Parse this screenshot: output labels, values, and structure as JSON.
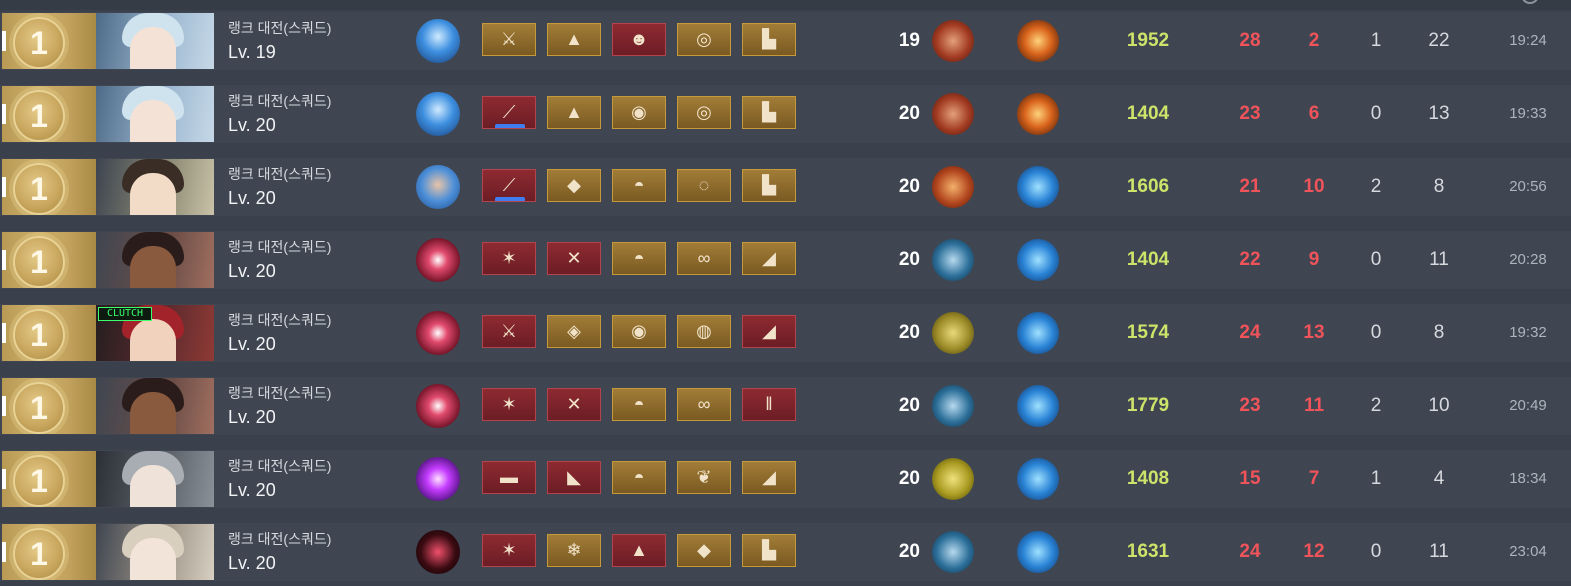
{
  "colors": {
    "score": "#cde36a",
    "kills": "#f0535a",
    "neutral": "#d6d9de",
    "time": "#aeb4bd"
  },
  "rows": [
    {
      "placement": "1",
      "mode": "랭크 대전(스쿼드)",
      "level_label": "Lv. 19",
      "char_level": "19",
      "score": "1952",
      "kills": "28",
      "assists": "2",
      "deaths": "1",
      "hunts": "22",
      "time": "19:24",
      "portrait_icon": "white-haired-character-icon",
      "skill_icon": "lightning-skill-icon",
      "weapon_icon": "sword-icon",
      "tactical_icon": "burst-tactical-icon",
      "badge": "",
      "items": [
        {
          "icon": "sword-item-icon",
          "tier": "gold"
        },
        {
          "icon": "red-cloak-icon",
          "tier": "gold"
        },
        {
          "icon": "mask-icon",
          "tier": "red"
        },
        {
          "icon": "bracelet-icon",
          "tier": "gold"
        },
        {
          "icon": "boots-icon",
          "tier": "gold"
        }
      ]
    },
    {
      "placement": "1",
      "mode": "랭크 대전(스쿼드)",
      "level_label": "Lv. 20",
      "char_level": "20",
      "score": "1404",
      "kills": "23",
      "assists": "6",
      "deaths": "0",
      "hunts": "13",
      "time": "19:33",
      "portrait_icon": "white-haired-character-icon",
      "skill_icon": "lightning-skill-icon",
      "weapon_icon": "sword-icon",
      "tactical_icon": "burst-tactical-icon",
      "badge": "",
      "items": [
        {
          "icon": "spear-item-icon",
          "tier": "red"
        },
        {
          "icon": "red-cloak-icon",
          "tier": "gold"
        },
        {
          "icon": "helmet-icon",
          "tier": "gold"
        },
        {
          "icon": "bracelet-icon",
          "tier": "gold"
        },
        {
          "icon": "boots-icon",
          "tier": "gold"
        }
      ]
    },
    {
      "placement": "1",
      "mode": "랭크 대전(스쿼드)",
      "level_label": "Lv. 20",
      "char_level": "20",
      "score": "1606",
      "kills": "21",
      "assists": "10",
      "deaths": "2",
      "hunts": "8",
      "time": "20:56",
      "portrait_icon": "green-haired-character-icon",
      "skill_icon": "fist-skill-icon",
      "weapon_icon": "bat-icon",
      "tactical_icon": "blink-tactical-icon",
      "badge": "",
      "items": [
        {
          "icon": "staff-item-icon",
          "tier": "red"
        },
        {
          "icon": "armor-icon",
          "tier": "gold"
        },
        {
          "icon": "cap-icon",
          "tier": "gold"
        },
        {
          "icon": "bangle-icon",
          "tier": "gold"
        },
        {
          "icon": "boots-icon",
          "tier": "gold"
        }
      ]
    },
    {
      "placement": "1",
      "mode": "랭크 대전(스쿼드)",
      "level_label": "Lv. 20",
      "char_level": "20",
      "score": "1404",
      "kills": "22",
      "assists": "9",
      "deaths": "0",
      "hunts": "11",
      "time": "20:28",
      "portrait_icon": "dark-haired-character-icon",
      "skill_icon": "grin-skill-icon",
      "weapon_icon": "shuriken-icon",
      "tactical_icon": "blink-tactical-icon",
      "badge": "",
      "items": [
        {
          "icon": "throwing-star-item-icon",
          "tier": "red"
        },
        {
          "icon": "harness-icon",
          "tier": "red"
        },
        {
          "icon": "cap-icon",
          "tier": "gold"
        },
        {
          "icon": "chain-icon",
          "tier": "gold"
        },
        {
          "icon": "glass-shoes-icon",
          "tier": "gold"
        }
      ]
    },
    {
      "placement": "1",
      "mode": "랭크 대전(스쿼드)",
      "level_label": "Lv. 20",
      "char_level": "20",
      "score": "1574",
      "kills": "24",
      "assists": "13",
      "deaths": "0",
      "hunts": "8",
      "time": "19:32",
      "portrait_icon": "red-haired-character-icon",
      "skill_icon": "grin-skill-icon",
      "weapon_icon": "crossbow-icon",
      "tactical_icon": "blink-tactical-icon",
      "badge": "CLUTCH",
      "items": [
        {
          "icon": "crossbow-item-icon",
          "tier": "red"
        },
        {
          "icon": "robe-icon",
          "tier": "gold"
        },
        {
          "icon": "helmet-icon",
          "tier": "gold"
        },
        {
          "icon": "gauntlet-icon",
          "tier": "gold"
        },
        {
          "icon": "red-shoes-icon",
          "tier": "red"
        }
      ]
    },
    {
      "placement": "1",
      "mode": "랭크 대전(스쿼드)",
      "level_label": "Lv. 20",
      "char_level": "20",
      "score": "1779",
      "kills": "23",
      "assists": "11",
      "deaths": "2",
      "hunts": "10",
      "time": "20:49",
      "portrait_icon": "dark-haired-character-icon",
      "skill_icon": "grin-skill-icon",
      "weapon_icon": "shuriken-icon",
      "tactical_icon": "blink-tactical-icon",
      "badge": "",
      "items": [
        {
          "icon": "throwing-star-item-icon",
          "tier": "red"
        },
        {
          "icon": "harness-icon",
          "tier": "red"
        },
        {
          "icon": "cap-icon",
          "tier": "gold"
        },
        {
          "icon": "chain-icon",
          "tier": "gold"
        },
        {
          "icon": "leg-armor-icon",
          "tier": "red"
        }
      ]
    },
    {
      "placement": "1",
      "mode": "랭크 대전(스쿼드)",
      "level_label": "Lv. 20",
      "char_level": "20",
      "score": "1408",
      "kills": "15",
      "assists": "7",
      "deaths": "1",
      "hunts": "4",
      "time": "18:34",
      "portrait_icon": "silver-haired-character-icon",
      "skill_icon": "burst-skill-icon",
      "weapon_icon": "dagger-icon",
      "tactical_icon": "blink-tactical-icon",
      "badge": "",
      "items": [
        {
          "icon": "rifle-item-icon",
          "tier": "red"
        },
        {
          "icon": "coat-icon",
          "tier": "red"
        },
        {
          "icon": "cap-icon",
          "tier": "gold"
        },
        {
          "icon": "feather-icon",
          "tier": "gold"
        },
        {
          "icon": "winged-boots-icon",
          "tier": "gold"
        }
      ]
    },
    {
      "placement": "1",
      "mode": "랭크 대전(스쿼드)",
      "level_label": "Lv. 20",
      "char_level": "20",
      "score": "1631",
      "kills": "24",
      "assists": "12",
      "deaths": "0",
      "hunts": "11",
      "time": "23:04",
      "portrait_icon": "blonde-character-icon",
      "skill_icon": "shadow-skill-icon",
      "weapon_icon": "shuriken-icon",
      "tactical_icon": "blink-tactical-icon",
      "badge": "",
      "items": [
        {
          "icon": "throwing-star-item-icon",
          "tier": "red"
        },
        {
          "icon": "dress-icon",
          "tier": "gold"
        },
        {
          "icon": "witch-hat-icon",
          "tier": "red"
        },
        {
          "icon": "dice-icon",
          "tier": "gold"
        },
        {
          "icon": "boots-icon",
          "tier": "gold"
        }
      ]
    }
  ]
}
